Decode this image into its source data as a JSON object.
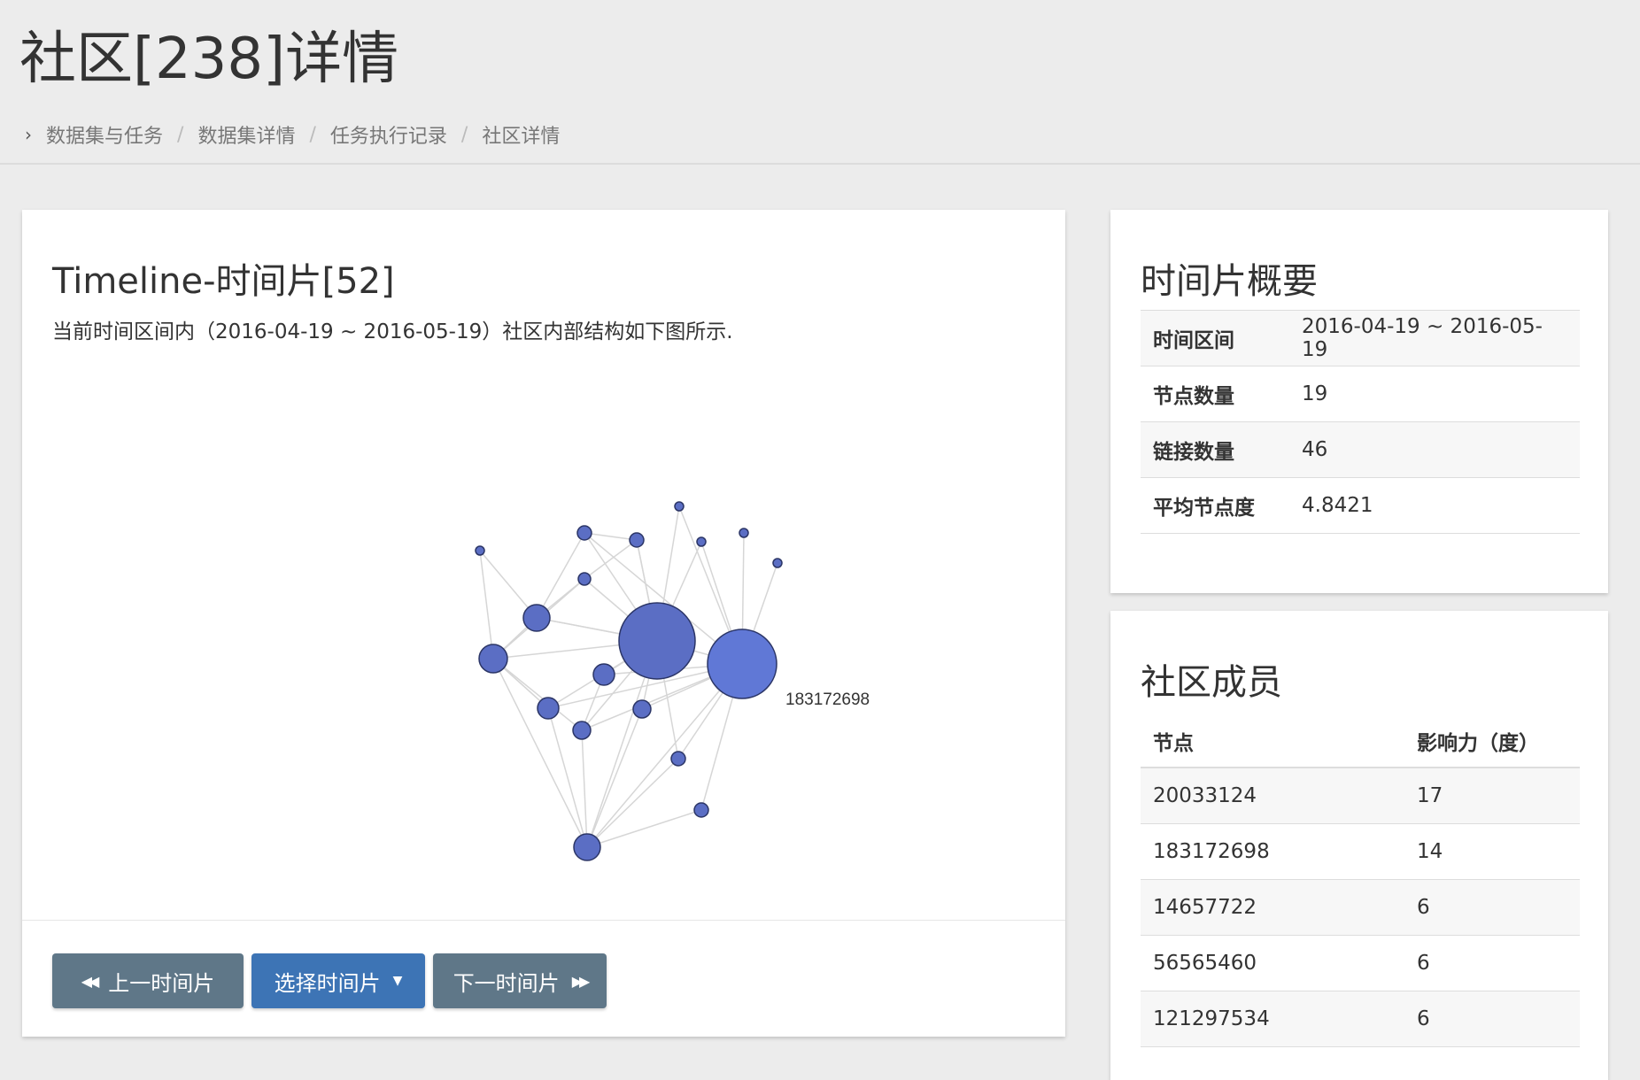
{
  "page": {
    "title": "社区[238]详情",
    "breadcrumb": [
      "数据集与任务",
      "数据集详情",
      "任务执行记录",
      "社区详情"
    ]
  },
  "timeline": {
    "title": "Timeline-时间片[52]",
    "description": "当前时间区间内（2016-04-19 ~ 2016-05-19）社区内部结构如下图所示.",
    "graph_label": "183172698",
    "buttons": {
      "prev": "上一时间片",
      "select": "选择时间片",
      "next": "下一时间片"
    }
  },
  "summary": {
    "title": "时间片概要",
    "rows": [
      {
        "key": "时间区间",
        "value": "2016-04-19 ~ 2016-05-19"
      },
      {
        "key": "节点数量",
        "value": "19"
      },
      {
        "key": "链接数量",
        "value": "46"
      },
      {
        "key": "平均节点度",
        "value": "4.8421"
      }
    ]
  },
  "members": {
    "title": "社区成员",
    "headers": [
      "节点",
      "影响力（度）"
    ],
    "rows": [
      [
        "20033124",
        "17"
      ],
      [
        "183172698",
        "14"
      ],
      [
        "14657722",
        "6"
      ],
      [
        "56565460",
        "6"
      ],
      [
        "121297534",
        "6"
      ]
    ]
  },
  "colors": {
    "node": "#5b6ec4",
    "node_highlight": "#6078d6",
    "edge": "#d6d6d6"
  }
}
